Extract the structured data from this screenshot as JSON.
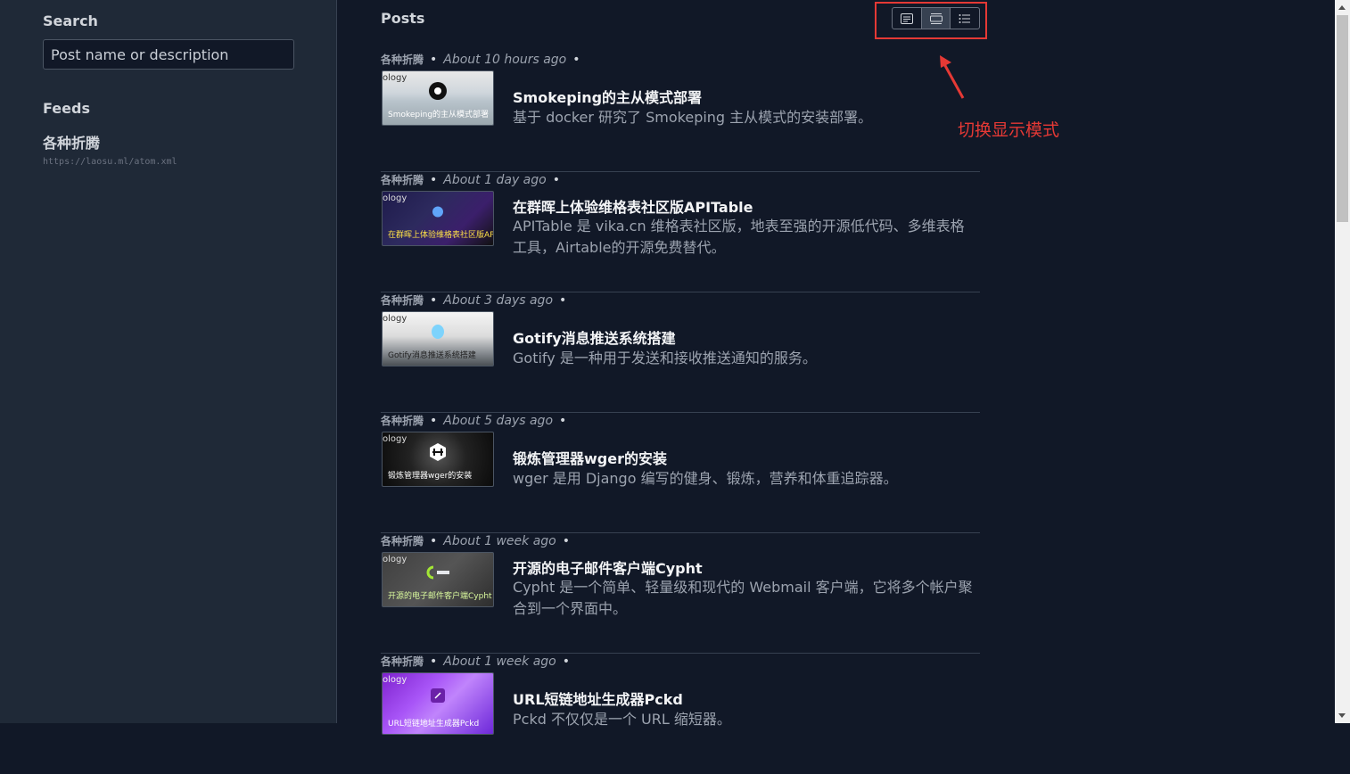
{
  "sidebar": {
    "search_title": "Search",
    "search_placeholder": "Post name or description",
    "feeds_title": "Feeds",
    "feeds": [
      {
        "name": "各种折腾",
        "url": "https://laosu.ml/atom.xml"
      }
    ]
  },
  "main": {
    "title": "Posts",
    "view_modes": [
      "card-view-icon",
      "banner-view-icon",
      "list-view-icon"
    ],
    "annotation": "切换显示模式",
    "annotation_color": "#e53935",
    "posts": [
      {
        "feed": "各种折腾",
        "time": "About 10 hours ago",
        "title": "Smokeping的主从模式部署",
        "description": "基于 docker 研究了 Smokeping 主从模式的安装部署。",
        "thumb_logo": "ology",
        "thumb_caption": "Smokeping的主从模式部署"
      },
      {
        "feed": "各种折腾",
        "time": "About 1 day ago",
        "title": "在群晖上体验维格表社区版APITable",
        "description": "APITable 是 vika.cn 维格表社区版，地表至强的开源低代码、多维表格工具，Airtable的开源免费替代。",
        "thumb_logo": "ology",
        "thumb_caption": "在群晖上体验维格表社区版APITable"
      },
      {
        "feed": "各种折腾",
        "time": "About 3 days ago",
        "title": "Gotify消息推送系统搭建",
        "description": "Gotify 是一种用于发送和接收推送通知的服务。",
        "thumb_logo": "ology",
        "thumb_caption": "Gotify消息推送系统搭建"
      },
      {
        "feed": "各种折腾",
        "time": "About 5 days ago",
        "title": "锻炼管理器wger的安装",
        "description": "wger 是用 Django 编写的健身、锻炼，营养和体重追踪器。",
        "thumb_logo": "ology",
        "thumb_caption": "锻炼管理器wger的安装"
      },
      {
        "feed": "各种折腾",
        "time": "About 1 week ago",
        "title": "开源的电子邮件客户端Cypht",
        "description": "Cypht 是一个简单、轻量级和现代的 Webmail 客户端，它将多个帐户聚合到一个界面中。",
        "thumb_logo": "ology",
        "thumb_caption": "开源的电子邮件客户端Cypht"
      },
      {
        "feed": "各种折腾",
        "time": "About 1 week ago",
        "title": "URL短链地址生成器Pckd",
        "description": "Pckd 不仅仅是一个 URL 缩短器。",
        "thumb_logo": "ology",
        "thumb_caption": "URL短链地址生成器Pckd"
      }
    ]
  }
}
